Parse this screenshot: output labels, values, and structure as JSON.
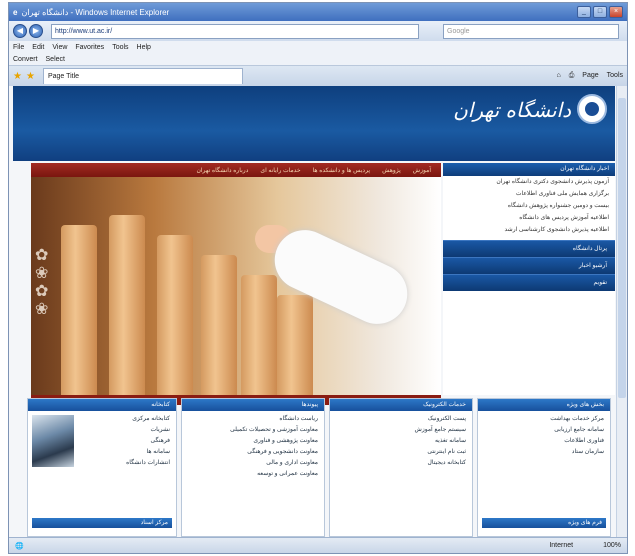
{
  "window": {
    "title": "دانشگاه تهران - Windows Internet Explorer"
  },
  "address": {
    "url": "http://www.ut.ac.ir/",
    "search_placeholder": "Google"
  },
  "menu": [
    "File",
    "Edit",
    "View",
    "Favorites",
    "Tools",
    "Help"
  ],
  "links": [
    "Convert",
    "Select"
  ],
  "tab": {
    "label": "Page Title"
  },
  "toolbar": [
    "Page",
    "Tools"
  ],
  "header": {
    "university_name": "دانشگاه تهران"
  },
  "main_nav": [
    "آموزش",
    "پژوهش",
    "پردیس ها و دانشکده ها",
    "خدمات رایانه ای",
    "درباره دانشگاه تهران"
  ],
  "news": {
    "title": "اخبار دانشگاه تهران",
    "items": [
      "آزمون پذیرش دانشجوی دکتری دانشگاه تهران",
      "برگزاری همایش ملی فناوری اطلاعات",
      "بیست و دومین جشنواره پژوهش دانشگاه",
      "اطلاعیه آموزش پردیس های دانشگاه",
      "اطلاعیه پذیرش دانشجوی کارشناسی ارشد"
    ]
  },
  "right_links": [
    "پرتال دانشگاه",
    "آرشیو اخبار",
    "تقویم"
  ],
  "panels": [
    {
      "title": "کتابخانه",
      "items": [
        "کتابخانه مرکزی",
        "نشریات",
        "فرهنگی",
        "سامانه ها",
        "انتشارات دانشگاه"
      ],
      "footer": "مرکز اسناد"
    },
    {
      "title": "پیوندها",
      "items": [
        "ریاست دانشگاه",
        "معاونت آموزشی و تحصیلات تکمیلی",
        "معاونت پژوهشی و فناوری",
        "معاونت دانشجویی و فرهنگی",
        "معاونت اداری و مالی",
        "معاونت عمرانی و توسعه"
      ]
    },
    {
      "title": "خدمات الکترونیک",
      "items": [
        "پست الکترونیک",
        "سیستم جامع آموزش",
        "سامانه تغذیه",
        "ثبت نام اینترنتی",
        "کتابخانه دیجیتال"
      ]
    },
    {
      "title": "بخش های ویژه",
      "items": [
        "مرکز خدمات بهداشت",
        "سامانه جامع ارزیابی",
        "فناوری اطلاعات",
        "سازمان ستاد"
      ],
      "footer": "فرم های ویژه"
    }
  ],
  "status": {
    "zone": "Internet",
    "zoom": "100%"
  }
}
